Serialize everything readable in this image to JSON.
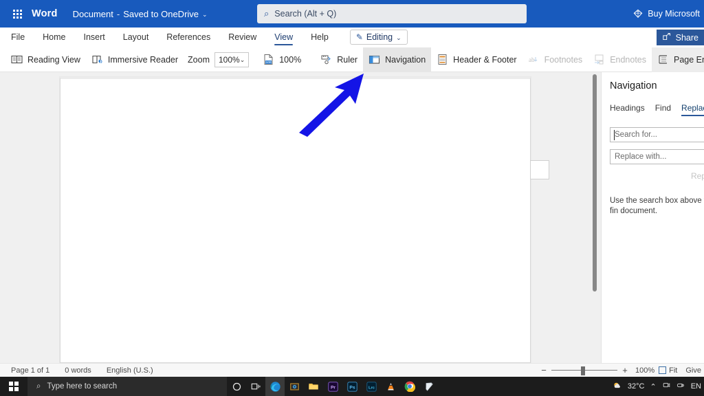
{
  "titlebar": {
    "waffle_name": "app-launcher",
    "app_name": "Word",
    "doc_name": "Document",
    "doc_dash": "-",
    "doc_state": "Saved to OneDrive",
    "chevron": "⌄",
    "buy_label": "Buy Microsoft"
  },
  "search": {
    "icon": "search-icon",
    "placeholder": "Search (Alt + Q)",
    "glyph": "⌕"
  },
  "ribbon": {
    "tabs": [
      {
        "label": "File",
        "selected": false
      },
      {
        "label": "Home",
        "selected": false
      },
      {
        "label": "Insert",
        "selected": false
      },
      {
        "label": "Layout",
        "selected": false
      },
      {
        "label": "References",
        "selected": false
      },
      {
        "label": "Review",
        "selected": false
      },
      {
        "label": "View",
        "selected": true
      },
      {
        "label": "Help",
        "selected": false
      }
    ],
    "editing_label": "Editing",
    "editing_chevron": "⌄",
    "share_label": "Share"
  },
  "commands": {
    "reading_view": "Reading View",
    "immersive_reader": "Immersive Reader",
    "zoom_label": "Zoom",
    "zoom_value": "100%",
    "zoom_chevron": "⌄",
    "zoom_100": "100%",
    "ruler": "Ruler",
    "navigation": "Navigation",
    "header_footer": "Header & Footer",
    "footnotes": "Footnotes",
    "endnotes": "Endnotes",
    "page_ends": "Page Ends"
  },
  "navpane": {
    "title": "Navigation",
    "tabs": [
      {
        "label": "Headings",
        "selected": false
      },
      {
        "label": "Find",
        "selected": false
      },
      {
        "label": "Replace",
        "selected": true
      }
    ],
    "search_placeholder": "Search for...",
    "replace_placeholder": "Replace with...",
    "replace_button": "Replace",
    "help_text": "Use the search box above to fin document."
  },
  "statusbar": {
    "page": "Page 1 of 1",
    "words": "0 words",
    "language": "English (U.S.)",
    "zoom_out": "−",
    "zoom_in": "+",
    "zoom_percent": "100%",
    "fit": "Fit",
    "feedback": "Give"
  },
  "taskbar": {
    "start_name": "windows-start-button",
    "search_placeholder": "Type here to search",
    "search_glyph": "⌕",
    "items": [
      {
        "name": "cortana-icon"
      },
      {
        "name": "task-view-icon"
      },
      {
        "name": "microsoft-edge-icon"
      },
      {
        "name": "photos-icon"
      },
      {
        "name": "file-explorer-icon"
      },
      {
        "name": "adobe-premiere-icon",
        "label": "Pr"
      },
      {
        "name": "adobe-photoshop-icon",
        "label": "Ps"
      },
      {
        "name": "lightroom-classic-icon",
        "label": "Lrc"
      },
      {
        "name": "vlc-media-player-icon"
      },
      {
        "name": "google-chrome-icon"
      },
      {
        "name": "notepad-icon"
      }
    ],
    "temperature": "32°C",
    "tray_chevron": "⌃",
    "language": "EN"
  },
  "annotation": {
    "arrow_name": "highlight-arrow",
    "arrow_color": "#1414e6"
  },
  "colors": {
    "word_blue": "#185abd",
    "accent": "#2b579a",
    "taskbar": "#1c1c1c"
  }
}
